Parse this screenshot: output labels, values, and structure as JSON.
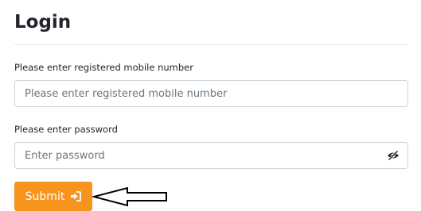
{
  "heading": "Login",
  "mobile": {
    "label": "Please enter registered mobile number",
    "placeholder": "Please enter registered mobile number",
    "value": ""
  },
  "password": {
    "label": "Please enter password",
    "placeholder": "Enter password",
    "value": "",
    "toggle_icon": "eye-slash-icon"
  },
  "submit": {
    "label": "Submit",
    "icon": "sign-in-icon",
    "color": "#f7941d"
  },
  "annotation": {
    "icon": "left-arrow-outline-icon"
  }
}
